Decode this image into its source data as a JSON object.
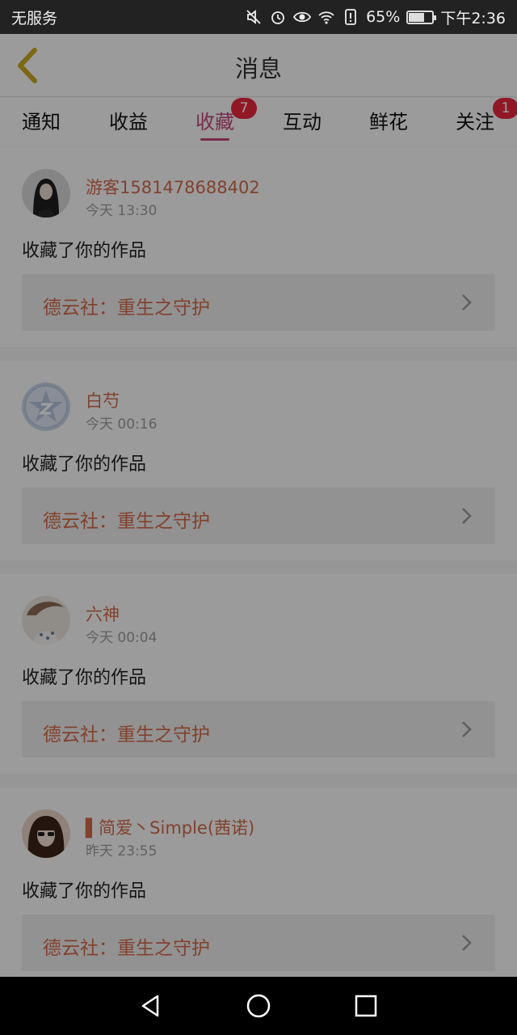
{
  "status_bar": {
    "carrier": "无服务",
    "battery_percent": "65%",
    "battery_level": 0.65,
    "time": "下午2:36",
    "icons": [
      "mute-icon",
      "alarm-icon",
      "eye-icon",
      "wifi-icon",
      "sim-alert-icon",
      "battery-icon"
    ]
  },
  "header": {
    "title": "消息",
    "back_icon": "chevron-left-icon"
  },
  "tabs": [
    {
      "label": "通知"
    },
    {
      "label": "收益"
    },
    {
      "label": "收藏",
      "badge": "7"
    },
    {
      "label": "互动"
    },
    {
      "label": "鲜花"
    },
    {
      "label": "关注",
      "badge": "1"
    }
  ],
  "active_tab": "收藏",
  "notifications": [
    {
      "user": "游客1581478688402",
      "time": "今天 13:30",
      "action": "收藏了你的作品",
      "work": "德云社：重生之守护"
    },
    {
      "user": "白芍",
      "time": "今天 00:16",
      "action": "收藏了你的作品",
      "work": "德云社：重生之守护"
    },
    {
      "user": "六神",
      "time": "今天 00:04",
      "action": "收藏了你的作品",
      "work": "德云社：重生之守护"
    },
    {
      "user": "▌简爱丶Simple(茜诺)",
      "time": "昨天 23:55",
      "action": "收藏了你的作品",
      "work": "德云社：重生之守护"
    }
  ],
  "colors": {
    "accent": "#c0477a",
    "name": "#d2694a",
    "badge": "#e8283c",
    "back_arrow": "#c9a820"
  },
  "nav_bar": {
    "icons": [
      "back-triangle-icon",
      "home-circle-icon",
      "recents-square-icon"
    ]
  }
}
